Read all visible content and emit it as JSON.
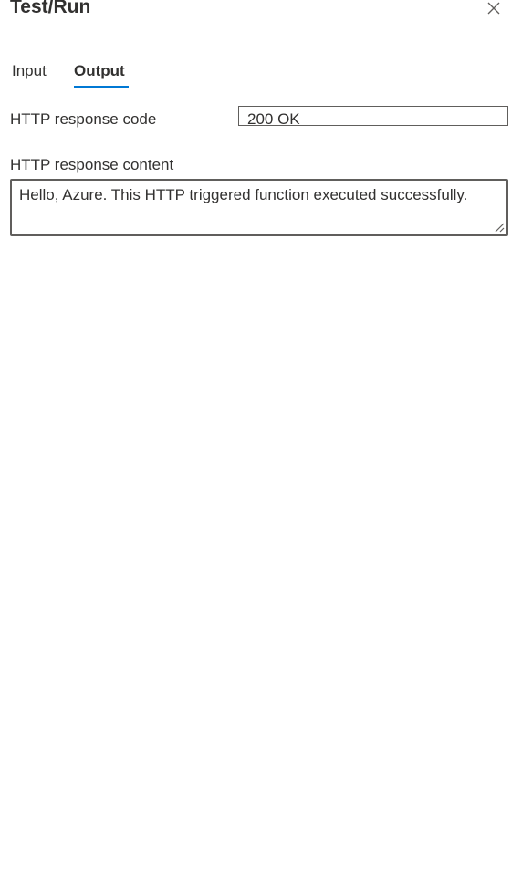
{
  "panel": {
    "title": "Test/Run",
    "close_icon": "close-icon"
  },
  "tabs": [
    {
      "label": "Input",
      "selected": false
    },
    {
      "label": "Output",
      "selected": true
    }
  ],
  "output": {
    "response_code_label": "HTTP response code",
    "response_code_value": "200 OK",
    "response_content_label": "HTTP response content",
    "response_content_value": "Hello, Azure. This HTTP triggered function executed successfully."
  },
  "colors": {
    "accent": "#0078d4",
    "text": "#323130",
    "border": "#605e5c"
  }
}
